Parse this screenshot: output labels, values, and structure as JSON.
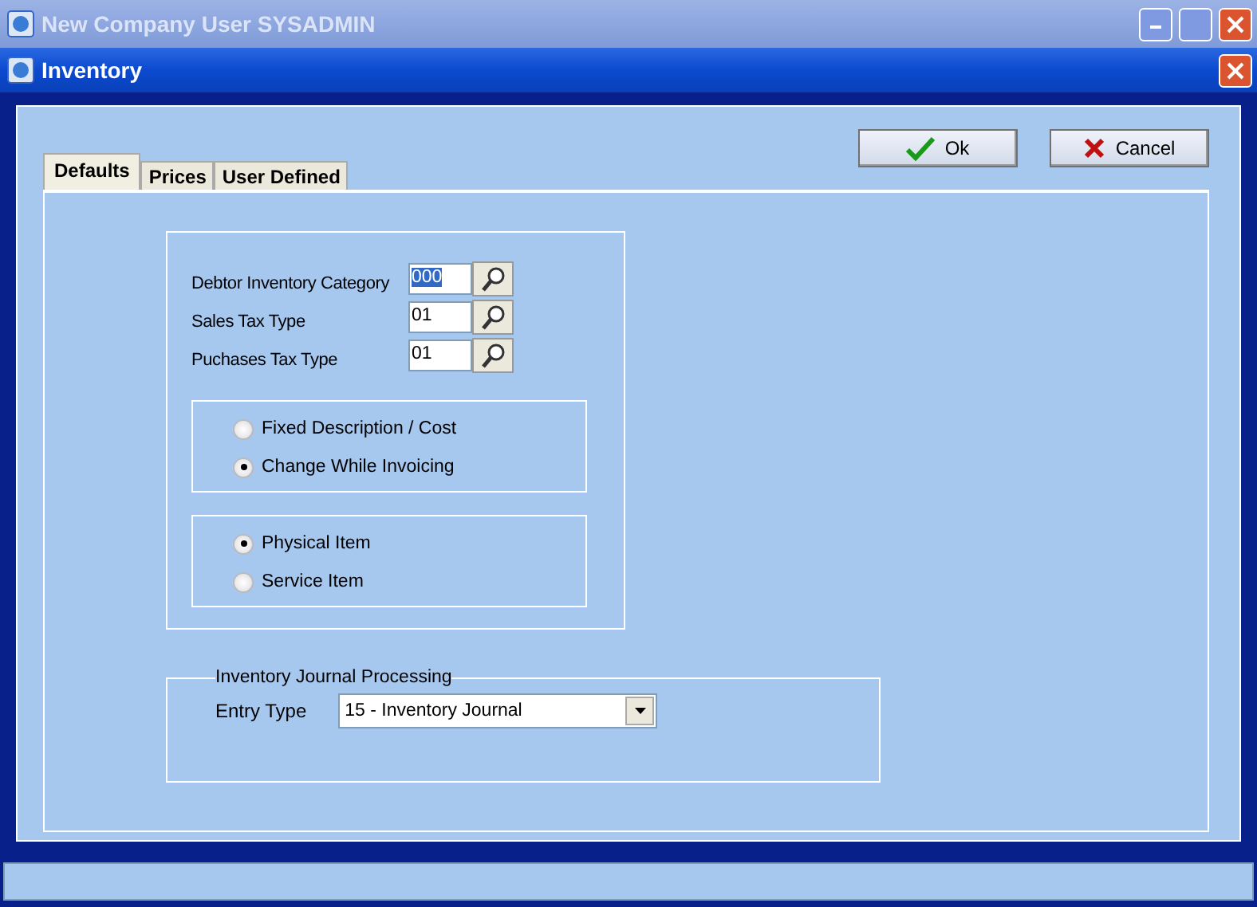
{
  "app_window": {
    "title": "New Company  User SYSADMIN"
  },
  "window": {
    "title": "Inventory"
  },
  "buttons": [
    {
      "kind": "ok",
      "label": "Ok"
    },
    {
      "kind": "cancel",
      "label": "Cancel"
    }
  ],
  "tabs": [
    {
      "label": "Defaults",
      "selected": true
    },
    {
      "label": "Prices",
      "selected": false
    },
    {
      "label": "User Defined",
      "selected": false
    }
  ],
  "fields": [
    {
      "label": "Debtor Inventory Category",
      "value": "000",
      "highlighted": true
    },
    {
      "label": "Sales Tax Type",
      "value": "01",
      "highlighted": false
    },
    {
      "label": "Puchases Tax Type",
      "value": "01",
      "highlighted": false
    }
  ],
  "radio_groups": [
    [
      {
        "label": "Fixed Description / Cost",
        "selected": false
      },
      {
        "label": "Change While Invoicing",
        "selected": true
      }
    ],
    [
      {
        "label": "Physical Item",
        "selected": true
      },
      {
        "label": "Service Item",
        "selected": false
      }
    ]
  ],
  "journal": {
    "legend": "Inventory Journal Processing",
    "label": "Entry Type",
    "value": "15 - Inventory Journal"
  }
}
